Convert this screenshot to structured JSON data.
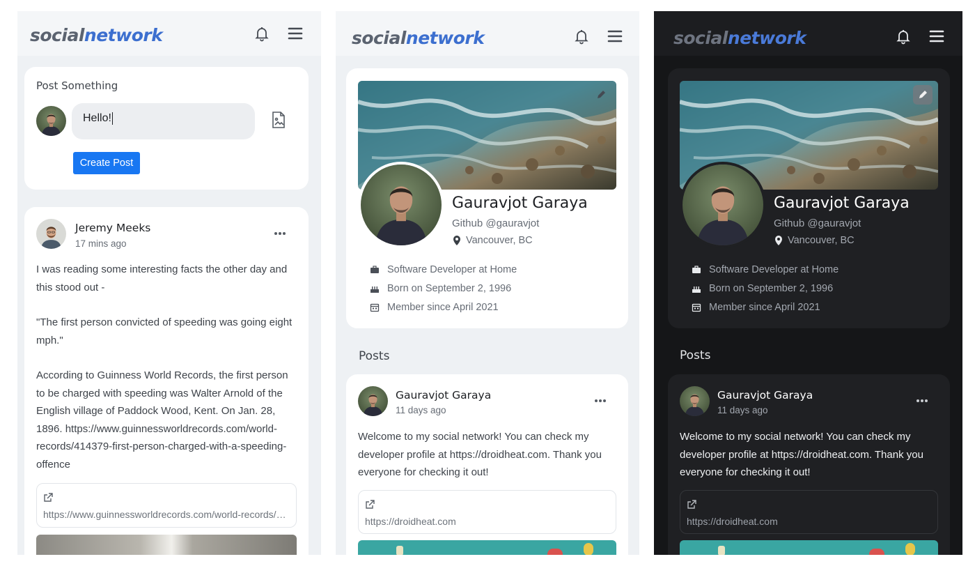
{
  "brand": {
    "word1": "social",
    "word2": "network"
  },
  "feed": {
    "composer": {
      "title": "Post Something",
      "input_value": "Hello!",
      "button": "Create Post"
    },
    "post": {
      "author": "Jeremy Meeks",
      "time": "17 mins ago",
      "paragraphs": [
        "I was reading some interesting facts the other day and this stood out -",
        "\"The first person convicted of speeding was going eight mph.\"",
        "According to Guinness World Records, the first person to be charged with speeding was Walter Arnold of the English village of Paddock Wood, Kent. On Jan. 28, 1896. https://www.guinnessworldrecords.com/world-records/414379-first-person-charged-with-a-speeding-offence"
      ],
      "link_url": "https://www.guinnessworldrecords.com/world-records/414379-first-person-charged-with-a-speeding-offence"
    }
  },
  "profile": {
    "name": "Gauravjot Garaya",
    "github": "Github @gauravjot",
    "location": "Vancouver, BC",
    "job": "Software Developer at Home",
    "born": "Born on September 2, 1996",
    "member_since": "Member since April 2021",
    "posts_label": "Posts",
    "post": {
      "author": "Gauravjot Garaya",
      "time": "11 days ago",
      "text": "Welcome to my social network! You can check my developer profile at https://droidheat.com. Thank you everyone for checking it out!",
      "link_url": "https://droidheat.com"
    }
  },
  "colors": {
    "accent": "#1877f2",
    "brand_blue": "#3c6fcf",
    "light_bg": "#eef1f4",
    "dark_bg": "#151618",
    "dark_card": "#1f2023"
  },
  "icons": [
    "bell-icon",
    "menu-icon",
    "document-icon",
    "more-icon",
    "external-link-icon",
    "edit-icon",
    "location-icon",
    "briefcase-icon",
    "cake-icon",
    "calendar-icon"
  ]
}
